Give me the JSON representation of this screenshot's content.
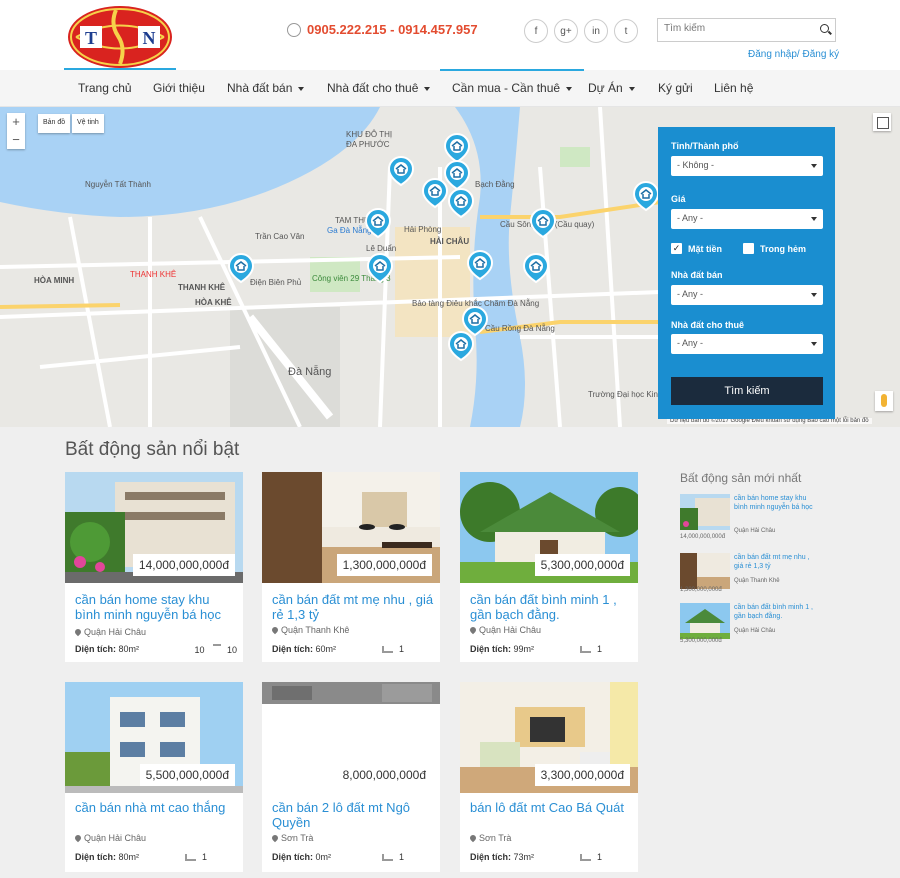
{
  "header": {
    "phone": "0905.222.215 - 0914.457.957",
    "socials": [
      "f",
      "g+",
      "in",
      "t"
    ],
    "search_placeholder": "Tìm kiếm",
    "login": "Đăng nhập/ Đăng ký"
  },
  "nav": [
    {
      "label": "Trang chủ",
      "dropdown": false
    },
    {
      "label": "Giới thiệu",
      "dropdown": false
    },
    {
      "label": "Nhà đất bán",
      "dropdown": true
    },
    {
      "label": "Nhà đất cho thuê",
      "dropdown": true
    },
    {
      "label": "Cần mua - Cần thuê",
      "dropdown": true
    },
    {
      "label": "Dự Án",
      "dropdown": true
    },
    {
      "label": "Ký gửi",
      "dropdown": false
    },
    {
      "label": "Liên hệ",
      "dropdown": false
    }
  ],
  "map": {
    "tab_map": "Bản đồ",
    "tab_satellite": "Vệ tinh",
    "zoom_in": "+",
    "zoom_out": "−",
    "labels": {
      "khu_do_thi": "KHU ĐÔ THỊ",
      "da_phuoc": "ĐA PHƯỚC",
      "hai_chau": "HẢI CHÂU",
      "tam_thuan": "TAM THUẬN",
      "ga_da_nang": "Ga Đà Nẵng",
      "thanh_khe": "THANH KHÊ",
      "hoa_khe": "HÒA KHÊ",
      "hoa_minh": "HÒA MINH",
      "da_nang": "Đà Nẵng",
      "cong_vien": "Công viên 29 Tháng 3",
      "cau_song_han": "Cầu Sông Hàn (Cầu quay)",
      "bao_tang": "Bảo tàng Điêu khắc Chăm Đà Nẵng",
      "cau_rong": "Cầu Rồng Đà Nẵng",
      "truong_dai_hoc": "Trường Đại học Kinh tế Đà Nẵng",
      "tran_cao_van": "Trần Cao Vân",
      "dien_bien_phu": "Điện Biên Phủ",
      "nguyen_tat_thanh": "Nguyễn Tất Thành",
      "bach_dang": "Bạch Đằng",
      "le_duan": "Lê Duẩn",
      "hai_phong": "Hải Phòng"
    },
    "footer": "Dữ liệu bản đồ ©2017 Google   Điều khoản sử dụng   Báo cáo một lỗi bản đồ"
  },
  "filter": {
    "city_label": "Tỉnh/Thành phố",
    "city_value": "- Không -",
    "price_label": "Giá",
    "price_value": "- Any -",
    "check1": "Mặt tiền",
    "check1_checked": "✓",
    "check2": "Trong hẻm",
    "sale_label": "Nhà đất bán",
    "sale_value": "- Any -",
    "rent_label": "Nhà đất cho thuê",
    "rent_value": "- Any -",
    "button": "Tìm kiếm"
  },
  "featured_title": "Bất động sản nổi bật",
  "listings": [
    {
      "price": "14,000,000,000đ",
      "title": "cần bán home stay khu bình minh nguyễn bá học",
      "location": "Quận Hải Châu",
      "area_label": "Diện tích:",
      "area": "80m²",
      "beds": "10",
      "baths": "10"
    },
    {
      "price": "1,300,000,000đ",
      "title": "cần bán đất mt mẹ nhu , giá rẻ 1,3 tỷ",
      "location": "Quận Thanh Khê",
      "area_label": "Diện tích:",
      "area": "60m²",
      "beds": "1"
    },
    {
      "price": "5,300,000,000đ",
      "title": "cần bán đất bình minh 1 , gần bạch đằng.",
      "location": "Quận Hải Châu",
      "area_label": "Diện tích:",
      "area": "99m²",
      "beds": "1"
    },
    {
      "price": "5,500,000,000đ",
      "title": "cần bán nhà mt cao thắng",
      "location": "Quận Hải Châu",
      "area_label": "Diện tích:",
      "area": "80m²",
      "beds": "1"
    },
    {
      "price": "8,000,000,000đ",
      "title": "cần bán 2 lô đất mt Ngô Quyền",
      "location": "Sơn Trà",
      "area_label": "Diện tích:",
      "area": "0m²",
      "beds": "1"
    },
    {
      "price": "3,300,000,000đ",
      "title": "bán lô đất mt Cao Bá Quát",
      "location": "Sơn Trà",
      "area_label": "Diện tích:",
      "area": "73m²",
      "beds": "1"
    }
  ],
  "latest_title": "Bất động sản mới nhất",
  "latest": [
    {
      "title": "cần bán home stay khu bình minh nguyễn bá học",
      "location": "Quận Hải Châu",
      "price": "14,000,000,000đ"
    },
    {
      "title": "cần bán đất mt mẹ nhu , giá rẻ 1,3 tỷ",
      "location": "Quận Thanh Khê",
      "price": "1,300,000,000đ"
    },
    {
      "title": "cần bán đất bình minh 1 , gần bạch đằng.",
      "location": "Quận Hải Châu",
      "price": "5,300,000,000đ"
    }
  ],
  "colors": {
    "accent": "#2aa8df",
    "filter_bg": "#1a8ed0",
    "phone": "#e34c30",
    "link": "#2a8fd4"
  }
}
